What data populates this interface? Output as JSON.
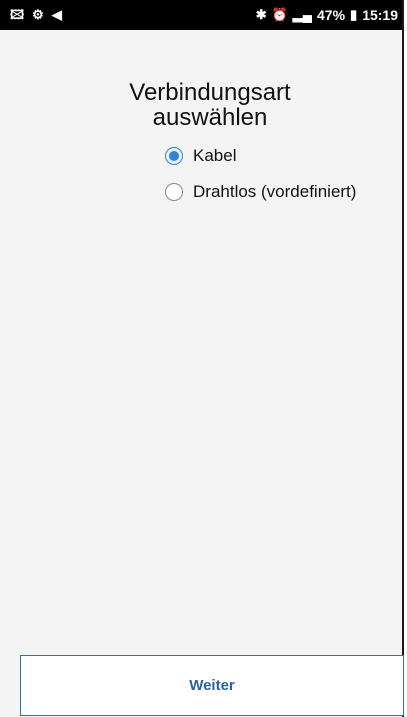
{
  "status_bar": {
    "left_icons": [
      "image-icon",
      "data-saver-icon",
      "send-icon"
    ],
    "right_icons": [
      "bluetooth-icon",
      "alarm-icon",
      "signal-icon",
      "battery-icon"
    ],
    "battery": "47%",
    "time": "15:19"
  },
  "page": {
    "title_line1": "Verbindungsart",
    "title_line2": "auswählen"
  },
  "options": [
    {
      "label": "Kabel",
      "selected": true
    },
    {
      "label": "Drahtlos (vordefiniert)",
      "selected": false
    }
  ],
  "footer": {
    "next_label": "Weiter"
  },
  "colors": {
    "accent": "#2f84d6",
    "button_text": "#2d5fa3",
    "background": "#f4f4f4"
  }
}
